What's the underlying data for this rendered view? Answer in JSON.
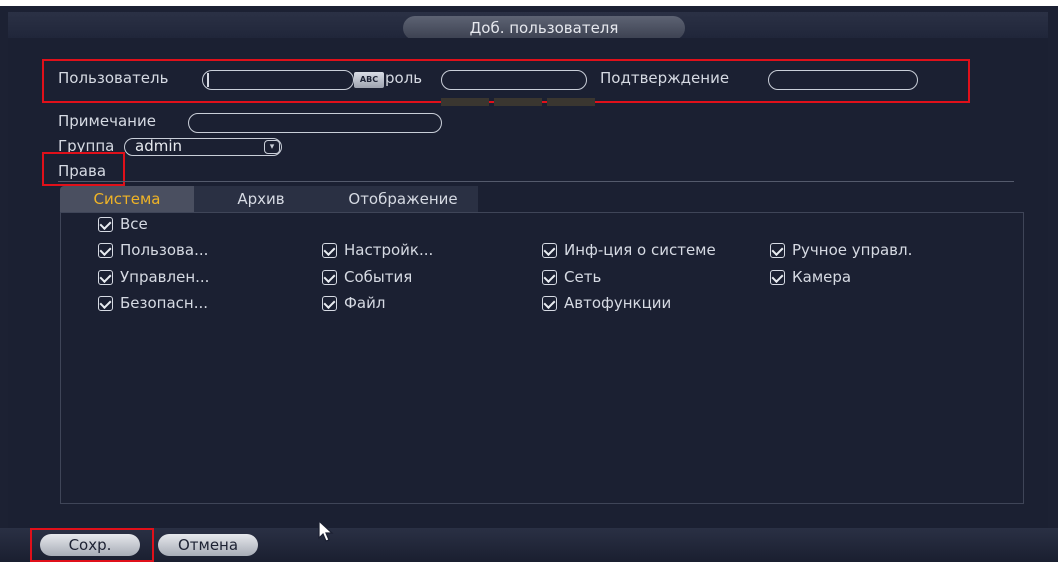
{
  "dialog": {
    "title": "Доб. пользователя"
  },
  "form": {
    "user_label": "Пользователь",
    "user_value": "",
    "keyboard_label": "ABC",
    "password_label": "роль",
    "password_value": "",
    "confirm_label": "Подтверждение",
    "confirm_value": "",
    "note_label": "Примечание",
    "note_value": "",
    "group_label": "Группа",
    "group_value": "admin",
    "rights_label": "Права"
  },
  "tabs": [
    {
      "label": "Система",
      "active": true
    },
    {
      "label": "Архив",
      "active": false
    },
    {
      "label": "Отображение",
      "active": false
    }
  ],
  "permissions": {
    "all": {
      "label": "Все",
      "checked": true
    },
    "items": [
      {
        "label": "Пользова...",
        "checked": true
      },
      {
        "label": "Настройк...",
        "checked": true
      },
      {
        "label": "Инф-ция о системе",
        "checked": true
      },
      {
        "label": "Ручное управл.",
        "checked": true
      },
      {
        "label": "Управлен...",
        "checked": true
      },
      {
        "label": "События",
        "checked": true
      },
      {
        "label": "Сеть",
        "checked": true
      },
      {
        "label": "Камера",
        "checked": true
      },
      {
        "label": "Безопасн...",
        "checked": true
      },
      {
        "label": "Файл",
        "checked": true
      },
      {
        "label": "Автофункции",
        "checked": true
      }
    ]
  },
  "buttons": {
    "save": "Сохр.",
    "cancel": "Отмена"
  },
  "colors": {
    "background": "#1c2133",
    "active_tab_text": "#f0b426",
    "highlight": "#e0101a"
  },
  "icons": [
    "checkbox-checked-icon",
    "dropdown-arrow-icon",
    "keyboard-icon",
    "mouse-cursor-icon"
  ]
}
